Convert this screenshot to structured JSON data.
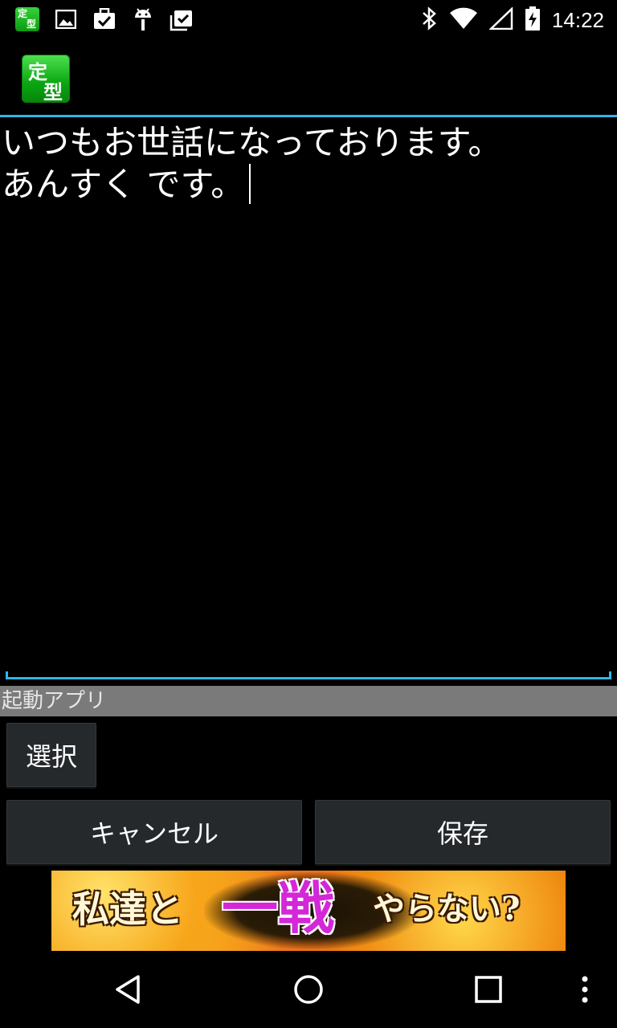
{
  "status_bar": {
    "time": "14:22",
    "left_icons": [
      "app-notification-icon",
      "image-icon",
      "task-check-icon",
      "android-debug-icon",
      "clipboard-check-icon"
    ],
    "right_icons": [
      "bluetooth-icon",
      "wifi-icon",
      "cell-signal-icon",
      "battery-charging-icon"
    ],
    "mini_app_glyph_1": "定",
    "mini_app_glyph_2": "型"
  },
  "action_bar": {
    "app_icon_glyph_1": "定",
    "app_icon_glyph_2": "型"
  },
  "editor": {
    "line_1": "いつもお世話になっております。",
    "line_2": "あんすく です。"
  },
  "launch_app": {
    "section_label": "起動アプリ",
    "select_button": "選択"
  },
  "actions": {
    "cancel_label": "キャンセル",
    "save_label": "保存"
  },
  "ad": {
    "text_1": "私達と",
    "text_2": "一戦",
    "text_3": "やらない?"
  },
  "nav_bar": {
    "icons": [
      "back-icon",
      "home-icon",
      "recents-icon",
      "overflow-menu-icon"
    ]
  },
  "colors": {
    "accent": "#33b5e5",
    "button_bg": "#26292c",
    "section_bg": "#7a7a7a",
    "app_icon_green": "#0aa511"
  }
}
